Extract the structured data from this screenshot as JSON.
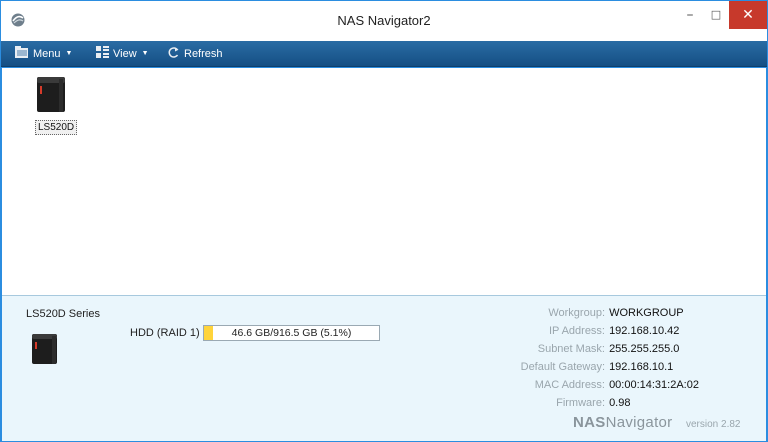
{
  "window": {
    "title": "NAS Navigator2"
  },
  "titlebar": {
    "minimize": "–",
    "maximize": "□",
    "close": "✕"
  },
  "toolbar": {
    "menu_label": "Menu",
    "view_label": "View",
    "refresh_label": "Refresh"
  },
  "devices": [
    {
      "name": "LS520D"
    }
  ],
  "info": {
    "series": "LS520D Series",
    "hdd_label": "HDD (RAID 1)",
    "hdd_usage": "46.6 GB/916.5 GB (5.1%)",
    "hdd_percent": 5.1,
    "fields": [
      {
        "key": "Workgroup:",
        "value": "WORKGROUP"
      },
      {
        "key": "IP Address:",
        "value": "192.168.10.42"
      },
      {
        "key": "Subnet Mask:",
        "value": "255.255.255.0"
      },
      {
        "key": "Default Gateway:",
        "value": "192.168.10.1"
      },
      {
        "key": "MAC Address:",
        "value": "00:00:14:31:2A:02"
      },
      {
        "key": "Firmware:",
        "value": "0.98"
      }
    ],
    "brand_nas": "NAS",
    "brand_navigator": "Navigator",
    "version": "version 2.82"
  },
  "colors": {
    "titlebar_bg": "#ffffff",
    "toolbar_bg": "#1f5e96",
    "close_button": "#c7392b",
    "info_panel_bg": "#eaf6fc",
    "hdd_fill": "#ffd43b"
  }
}
